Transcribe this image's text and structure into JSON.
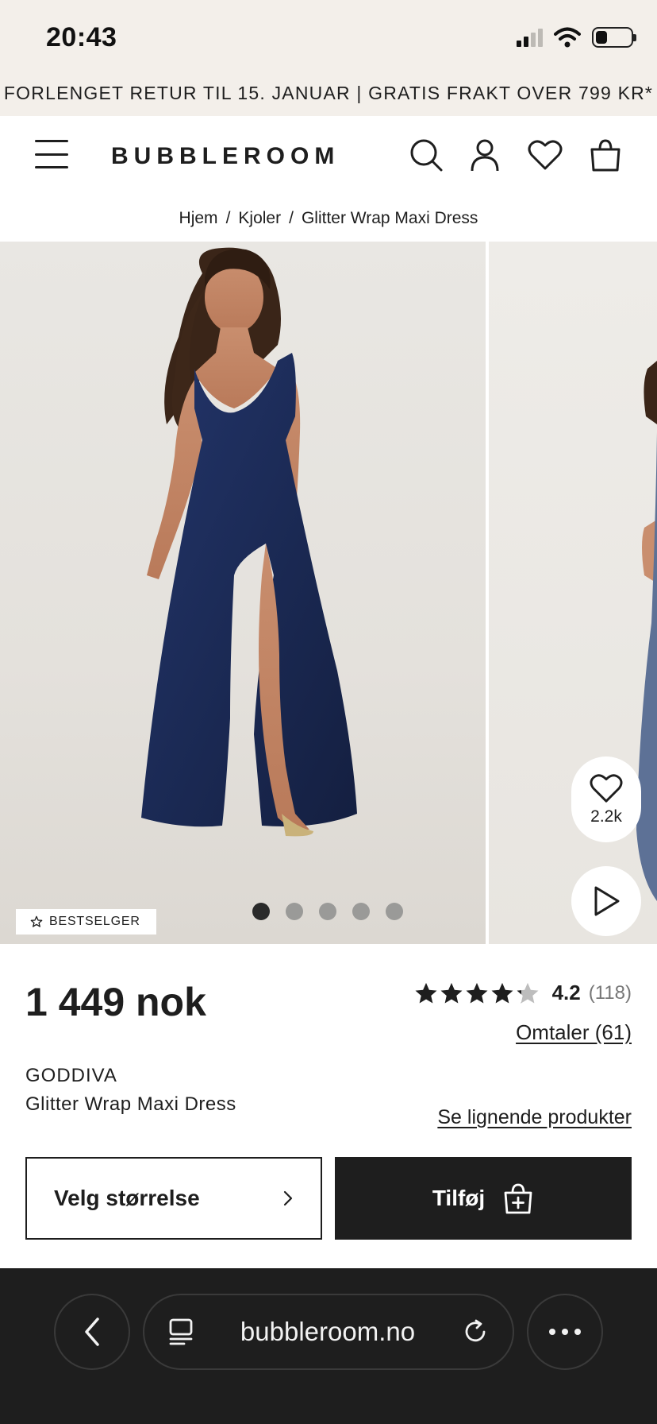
{
  "status_bar": {
    "time": "20:43"
  },
  "promo_banner": {
    "text": "FORLENGET RETUR TIL 15. JANUAR | GRATIS FRAKT OVER 799 KR*"
  },
  "header": {
    "logo": "BUBBLEROOM",
    "icons": [
      "menu-icon",
      "search-icon",
      "account-icon",
      "wishlist-icon",
      "bag-icon"
    ]
  },
  "breadcrumb": {
    "items": [
      "Hjem",
      "Kjoler",
      "Glitter Wrap Maxi Dress"
    ],
    "separator": "/"
  },
  "gallery": {
    "badge": "BESTSELGER",
    "image_count": 5,
    "active_index": 0,
    "favorites_count": "2.2k"
  },
  "product": {
    "price": "1 449 nok",
    "rating": "4.2",
    "rating_value": 4.2,
    "rating_count": "(118)",
    "reviews_link": "Omtaler (61)",
    "brand": "GODDIVA",
    "name": "Glitter Wrap Maxi Dress",
    "similar_link": "Se lignende produkter"
  },
  "actions": {
    "size_button": "Velg størrelse",
    "add_button": "Tilføj"
  },
  "browser": {
    "url": "bubbleroom.no"
  },
  "colors": {
    "dark": "#1e1e1e",
    "banner_bg": "#f3efea",
    "dress_navy": "#1b2a55"
  }
}
